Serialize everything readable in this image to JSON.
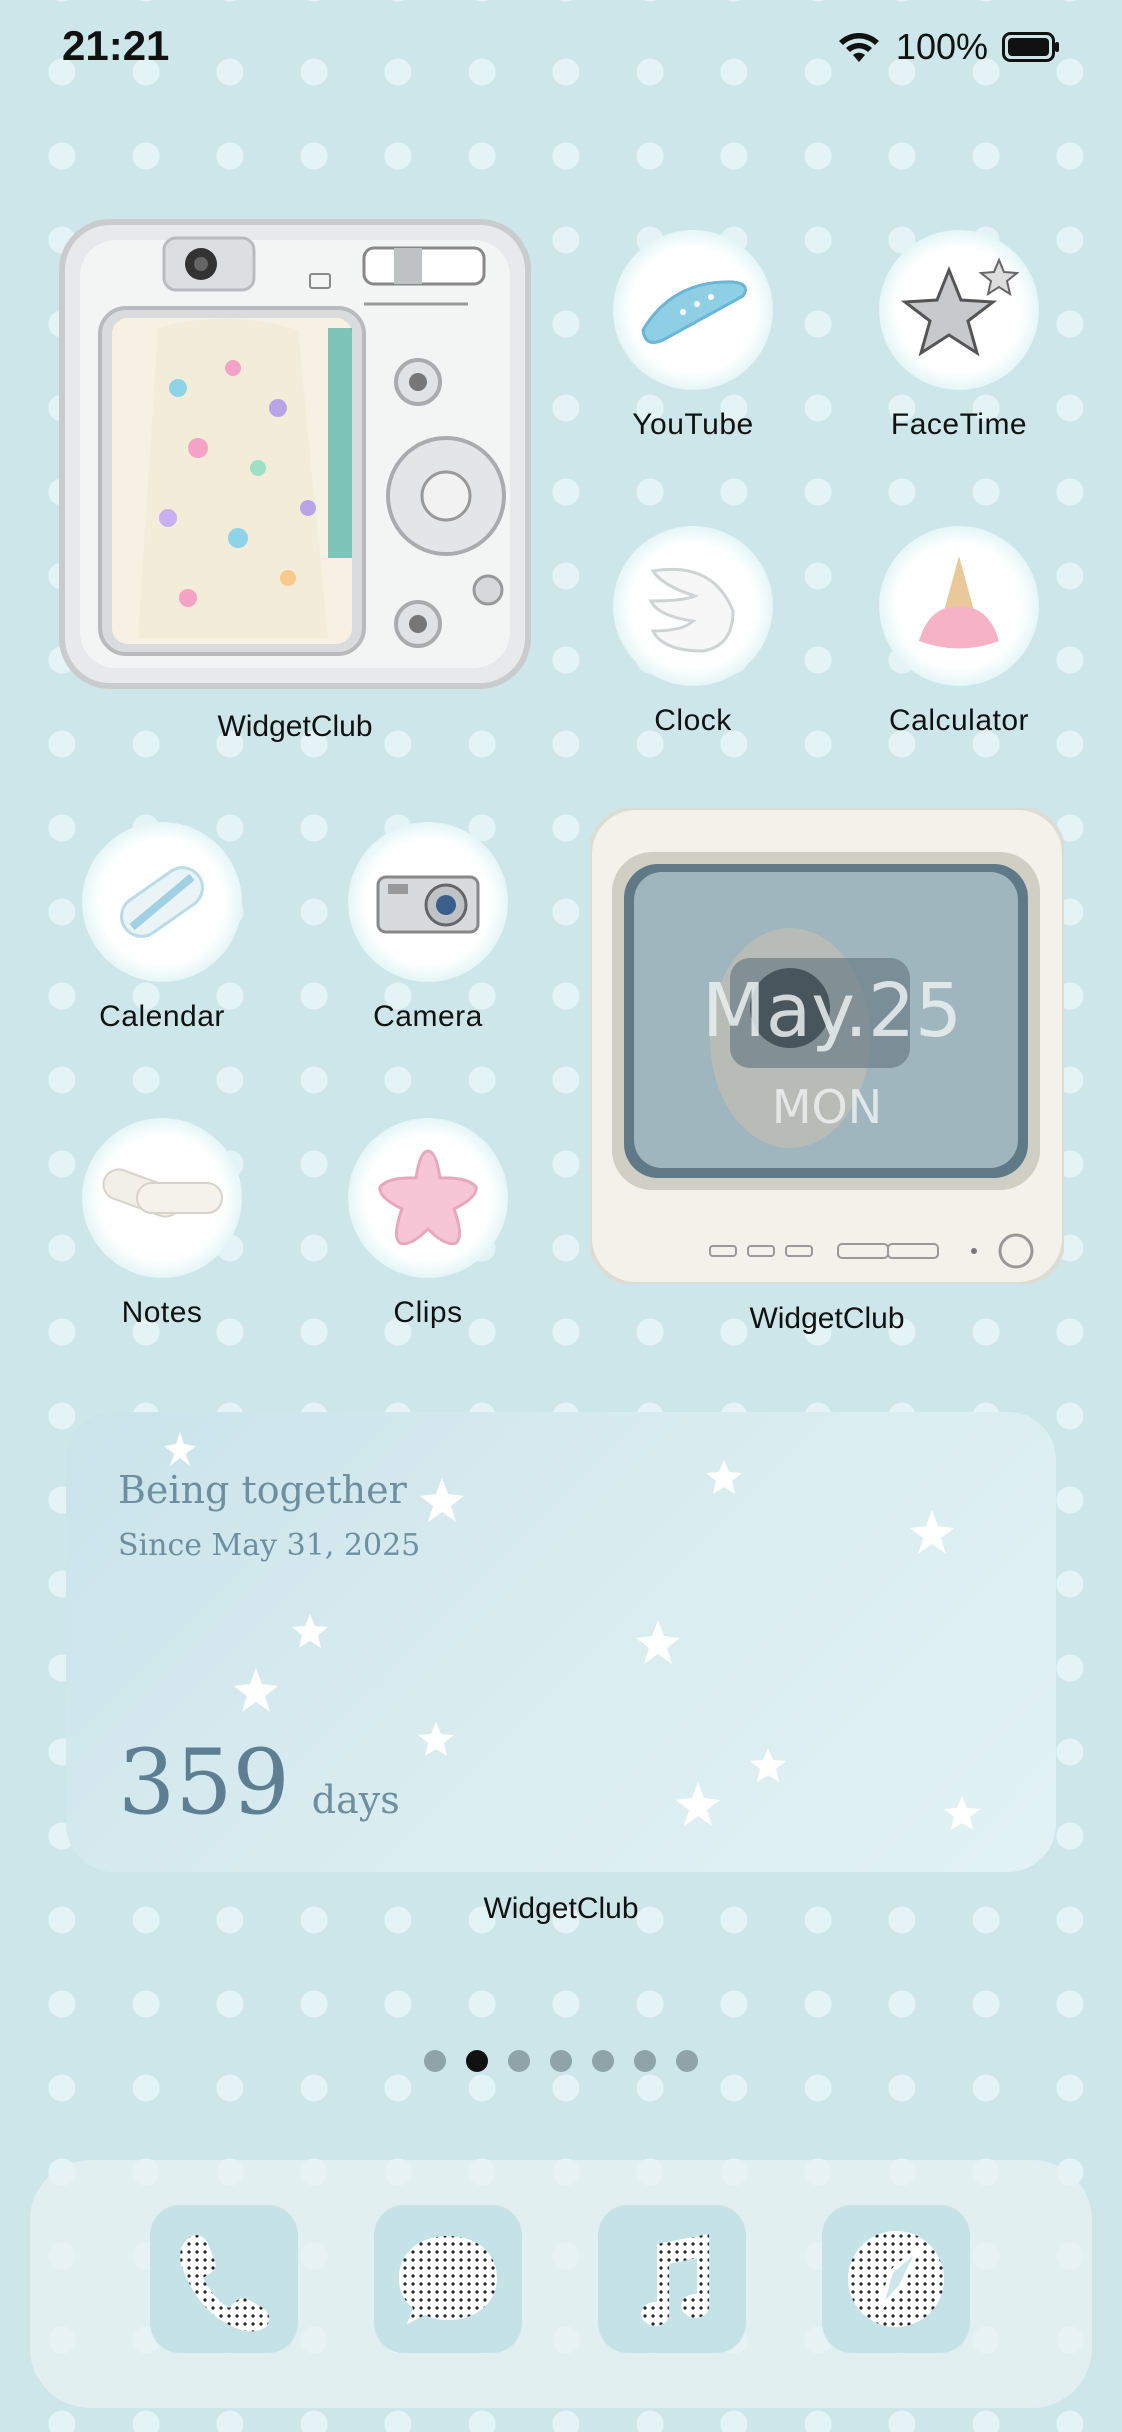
{
  "status": {
    "time": "21:21",
    "battery": "100%"
  },
  "apps": [
    {
      "label": "YouTube",
      "icon": "hairclip-icon"
    },
    {
      "label": "FaceTime",
      "icon": "chrome-star-icon"
    },
    {
      "label": "Clock",
      "icon": "wing-icon"
    },
    {
      "label": "Calculator",
      "icon": "ice-cream-icon"
    },
    {
      "label": "Calendar",
      "icon": "marshmallow-icon"
    },
    {
      "label": "Camera",
      "icon": "camera-icon"
    },
    {
      "label": "Notes",
      "icon": "bandage-icon"
    },
    {
      "label": "Clips",
      "icon": "pink-star-icon"
    }
  ],
  "widgets": {
    "camera_widget": {
      "label": "WidgetClub"
    },
    "tv_widget": {
      "label": "WidgetClub",
      "date": "May.25",
      "day": "MON"
    },
    "together_widget": {
      "label": "WidgetClub",
      "line1": "Being together",
      "line2": "Since May 31, 2025",
      "count": "359",
      "unit": "days"
    }
  },
  "page_dots": {
    "count": 7,
    "active": 1
  },
  "dock": [
    {
      "icon": "phone-icon"
    },
    {
      "icon": "messages-icon"
    },
    {
      "icon": "music-icon"
    },
    {
      "icon": "safari-icon"
    }
  ]
}
